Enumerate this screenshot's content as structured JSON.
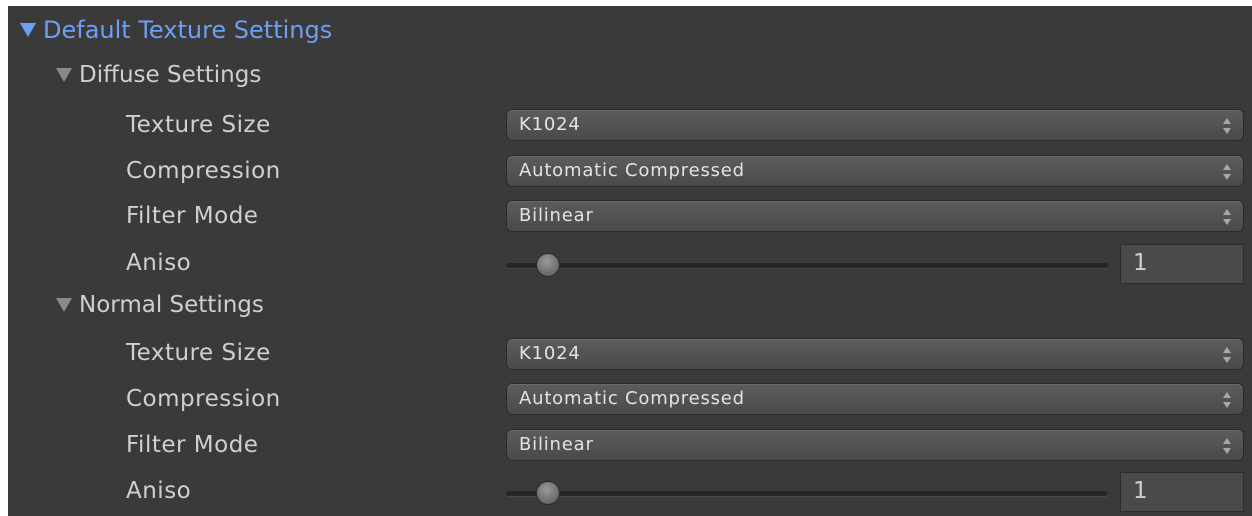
{
  "header": {
    "title": "Default Texture Settings"
  },
  "sections": [
    {
      "title": "Diffuse Settings",
      "fields": {
        "texture_size": {
          "label": "Texture Size",
          "value": "K1024"
        },
        "compression": {
          "label": "Compression",
          "value": "Automatic Compressed"
        },
        "filter_mode": {
          "label": "Filter Mode",
          "value": "Bilinear"
        },
        "aniso": {
          "label": "Aniso",
          "value": "1"
        }
      }
    },
    {
      "title": "Normal Settings",
      "fields": {
        "texture_size": {
          "label": "Texture Size",
          "value": "K1024"
        },
        "compression": {
          "label": "Compression",
          "value": "Automatic Compressed"
        },
        "filter_mode": {
          "label": "Filter Mode",
          "value": "Bilinear"
        },
        "aniso": {
          "label": "Aniso",
          "value": "1"
        }
      }
    }
  ],
  "colors": {
    "panel_background": "#3a3a3a",
    "header_accent": "#6e9ff4",
    "text": "#d0d0d0"
  },
  "icons": {
    "header_foldout": "triangle-down-icon",
    "section_foldout": "triangle-down-icon",
    "dropdown_arrows": "up-down-arrows-icon"
  }
}
